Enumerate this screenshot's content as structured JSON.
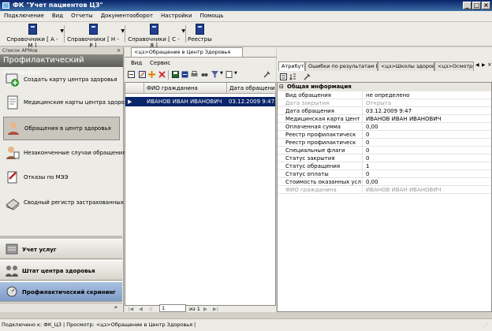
{
  "window": {
    "title": "ФК \"Учет пациентов ЦЗ\""
  },
  "menu": [
    "Подключение",
    "Вид",
    "Отчеты",
    "Документооборот",
    "Настройки",
    "Помощь"
  ],
  "toolbar": {
    "buttons": [
      "Справочники [ А - М ]",
      "Справочники [ Н - Р ]",
      "Справочники [ С - Я ]",
      "Реестры"
    ]
  },
  "left": {
    "header": "Список АРМов",
    "title": "Профилактический скрининг",
    "items": [
      "Создать карту центра здоровья",
      "Медицинские карты центра здоровья",
      "Обращения в центр здоровья",
      "Незаконченные случаи обращения",
      "Отказы по МЭЭ",
      "Сводный регистр застрахованных"
    ],
    "groups": [
      "Учет услуг",
      "Штат центра здоровья",
      "Профилактический скрининг"
    ]
  },
  "center": {
    "doc_tab": "<цз>Обращение в Центр Здоровья",
    "menu": [
      "Вид",
      "Сервис"
    ],
    "columns": [
      "ФИО гражданина",
      "Дата обращения"
    ],
    "rows": [
      {
        "name": "ИВАНОВ ИВАН ИВАНОВИЧ",
        "date": "03.12.2009 9:47:45"
      }
    ],
    "pager": {
      "page": "1",
      "of": "из 1"
    }
  },
  "right": {
    "tabs": [
      "Атрибуты",
      "Ошибки по результатам МЭЭ",
      "<цз>Школы здоровья",
      "<цз>Осмотры"
    ],
    "section": "Общая информация",
    "properties": [
      {
        "k": "Вид обращения",
        "v": "не определено",
        "gray": false
      },
      {
        "k": "Дата закрытия",
        "v": "Открыта",
        "gray": true
      },
      {
        "k": "Дата обращения",
        "v": "03.12.2009 9:47",
        "gray": false
      },
      {
        "k": "Медицинская карта Цент",
        "v": "ИВАНОВ ИВАН ИВАНОВИЧ",
        "gray": false
      },
      {
        "k": "Оплаченная сумма",
        "v": "0,00",
        "gray": false
      },
      {
        "k": "Реестр профилактическ",
        "v": "0",
        "gray": false
      },
      {
        "k": "Реестр профилактическ",
        "v": "0",
        "gray": false
      },
      {
        "k": "Специальные флаги",
        "v": "0",
        "gray": false
      },
      {
        "k": "Статус закрытия",
        "v": "0",
        "gray": false
      },
      {
        "k": "Статус обращения",
        "v": "1",
        "gray": false
      },
      {
        "k": "Статус оплаты",
        "v": "0",
        "gray": false
      },
      {
        "k": "Стоимость оказанных усл",
        "v": "0,00",
        "gray": false
      },
      {
        "k": "ФИО гражданина",
        "v": "ИВАНОВ ИВАН ИВАНОВИЧ",
        "gray": true
      }
    ]
  },
  "status": {
    "text": "Подключено к: ФК_ЦЗ   |   Просмотр: <цз>Обращение в Центр Здоровья |"
  }
}
